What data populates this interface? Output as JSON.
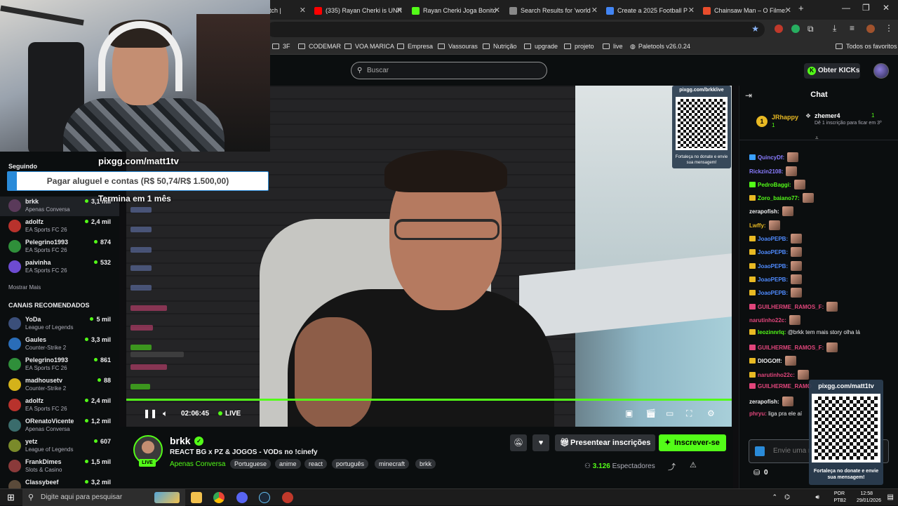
{
  "browser": {
    "tabs": [
      {
        "title": "tch |",
        "color": "#53fc18"
      },
      {
        "title": "(335) Rayan Cherki is UNR",
        "color": "#ff0000"
      },
      {
        "title": "Rayan Cherki Joga Bonito",
        "color": "#53fc18"
      },
      {
        "title": "Search Results for 'world",
        "color": "#888888"
      },
      {
        "title": "Create a 2025 Football P",
        "color": "#4285f4"
      },
      {
        "title": "Chainsaw Man – O Filme:",
        "color": "#e94d2c"
      }
    ],
    "new_tab": "+",
    "bookmarks": [
      "3F",
      "CODEMAR",
      "VOA MARICA",
      "Empresa",
      "Vassouras",
      "Nutrição",
      "upgrade",
      "projeto",
      "live",
      "Paletools v26.0.24"
    ],
    "all_bookmarks": "Todos os favoritos"
  },
  "kick": {
    "search_placeholder": "Buscar",
    "get_kicks": "Obter KICKs",
    "accent": "#53fc18"
  },
  "overlay": {
    "pixgg_url": "pixgg.com/matt1tv",
    "goal_text": "Pagar aluguel e contas (R$ 50,74/R$ 1.500,00)",
    "goal_progress": 0.034,
    "goal_end": "Termina em 1 mês",
    "qr_top_url": "pixgg.com/brkklive",
    "qr_top_caption": "Fortaleça no donate e envie sua mensagem!",
    "qr_right_url": "pixgg.com/matt1tv",
    "qr_right_caption": "Fortaleça no donate e envie sua mensagem!"
  },
  "sidebar": {
    "following_label": "Seguindo",
    "following": [
      {
        "name": "brkk",
        "category": "Apenas Conversa",
        "viewers": "3,1 mil",
        "color": "#5a3a5a"
      },
      {
        "name": "adolfz",
        "category": "EA Sports FC 26",
        "viewers": "2,4 mil",
        "color": "#b8322c"
      },
      {
        "name": "Pelegrino1993",
        "category": "EA Sports FC 26",
        "viewers": "874",
        "color": "#2f8f3a"
      },
      {
        "name": "paivinha",
        "category": "EA Sports FC 26",
        "viewers": "532",
        "color": "#6d4bd1"
      }
    ],
    "show_more": "Mostrar Mais",
    "recommended_label": "CANAIS RECOMENDADOS",
    "recommended": [
      {
        "name": "YoDa",
        "category": "League of Legends",
        "viewers": "5 mil",
        "color": "#3b4f7a"
      },
      {
        "name": "Gaules",
        "category": "Counter-Strike 2",
        "viewers": "3,3 mil",
        "color": "#2a6db8"
      },
      {
        "name": "Pelegrino1993",
        "category": "EA Sports FC 26",
        "viewers": "861",
        "color": "#2f8f3a"
      },
      {
        "name": "madhousetv",
        "category": "Counter-Strike 2",
        "viewers": "88",
        "color": "#d4b21a"
      },
      {
        "name": "adolfz",
        "category": "EA Sports FC 26",
        "viewers": "2,4 mil",
        "color": "#b8322c"
      },
      {
        "name": "ORenatoVicente",
        "category": "Apenas Conversa",
        "viewers": "1,2 mil",
        "color": "#3a6c6c"
      },
      {
        "name": "yetz",
        "category": "League of Legends",
        "viewers": "607",
        "color": "#7a8a2a"
      },
      {
        "name": "FrankDimes",
        "category": "Slots & Casino",
        "viewers": "1,5 mil",
        "color": "#8a3a3a"
      },
      {
        "name": "Classybeef",
        "category": "",
        "viewers": "3,2 mil",
        "color": "#5a4a3a"
      }
    ]
  },
  "player": {
    "time": "02:06:45",
    "live": "LIVE"
  },
  "streamer": {
    "name": "brkk",
    "live_badge": "LIVE",
    "title": "REACT BG x PZ & JOGOS - VODs no !cinefy",
    "category": "Apenas Conversa",
    "tags": [
      "Portuguese",
      "anime",
      "react",
      "português",
      "minecraft",
      "brkk"
    ],
    "gift_label": "Presentear inscrições",
    "subscribe_label": "Inscrever-se",
    "viewers_count": "3.126",
    "viewers_label": "Espectadores"
  },
  "chat": {
    "title": "Chat",
    "pinned": {
      "rank": "1",
      "user1": "JRhappy",
      "user1_count": "1",
      "user2": "zhemer4",
      "user2_count": "1",
      "user2_text": "Dê 1 inscrição para ficar em 3º"
    },
    "messages": [
      {
        "user": "QuincyDf:",
        "text": "",
        "color": "#8a7cff",
        "badge": "#3aa0ff",
        "emote": true
      },
      {
        "user": "Rickzin2108:",
        "text": "",
        "color": "#8a7cff",
        "badge": "",
        "emote": true
      },
      {
        "user": "PedroBaggi:",
        "text": "",
        "color": "#53fc18",
        "badge": "#53fc18",
        "emote": true
      },
      {
        "user": "Zoro_baiano77:",
        "text": "",
        "color": "#53fc18",
        "badge": "#e8b923",
        "emote": true
      },
      {
        "user": "zerapofish:",
        "text": "",
        "color": "#efeff1",
        "badge": "",
        "emote": true
      },
      {
        "user": "Lwffy:",
        "text": "",
        "color": "#e8b923",
        "badge": "",
        "emote": true
      },
      {
        "user": "JoaoPEPB:",
        "text": "",
        "color": "#4f8bff",
        "badge": "#e8b923",
        "emote": true
      },
      {
        "user": "JoaoPEPB:",
        "text": "",
        "color": "#4f8bff",
        "badge": "#e8b923",
        "emote": true
      },
      {
        "user": "JoaoPEPB:",
        "text": "",
        "color": "#4f8bff",
        "badge": "#e8b923",
        "emote": true
      },
      {
        "user": "JoaoPEPB:",
        "text": "",
        "color": "#4f8bff",
        "badge": "#e8b923",
        "emote": true
      },
      {
        "user": "JoaoPEPB:",
        "text": "",
        "color": "#4f8bff",
        "badge": "#e8b923",
        "emote": true
      },
      {
        "user": "GUILHERME_RAMOS_F:",
        "text": "",
        "color": "#e0457b",
        "badge": "#e0457b",
        "emote": true
      },
      {
        "user": "narutinho22c:",
        "text": "",
        "color": "#e0457b",
        "badge": "",
        "emote": true
      },
      {
        "user": "leozinnrlq:",
        "text": "@brkk tem mais story olha lá",
        "color": "#53fc18",
        "badge": "#e8b923",
        "emote": false
      },
      {
        "user": "GUILHERME_RAMOS_F:",
        "text": "",
        "color": "#e0457b",
        "badge": "#e0457b",
        "emote": true
      },
      {
        "user": "DIOGOff:",
        "text": "",
        "color": "#efeff1",
        "badge": "#e8b923",
        "emote": true
      },
      {
        "user": "narutinho22c:",
        "text": "",
        "color": "#e0457b",
        "badge": "#e8b923",
        "emote": true
      },
      {
        "user": "GUILHERME_RAMO",
        "text": "",
        "color": "#e0457b",
        "badge": "#e0457b",
        "emote": false
      },
      {
        "user": "zerapofish:",
        "text": "",
        "color": "#efeff1",
        "badge": "",
        "emote": true
      },
      {
        "user": "phryu:",
        "text": "liga pra ele aí",
        "color": "#e0457b",
        "badge": "",
        "emote": false
      }
    ],
    "input_placeholder": "Envie uma m",
    "kicks": "0"
  },
  "taskbar": {
    "search_placeholder": "Digite aqui para pesquisar",
    "lang1": "POR",
    "lang2": "PTB2",
    "time": "12:58",
    "date": "29/01/2026"
  }
}
